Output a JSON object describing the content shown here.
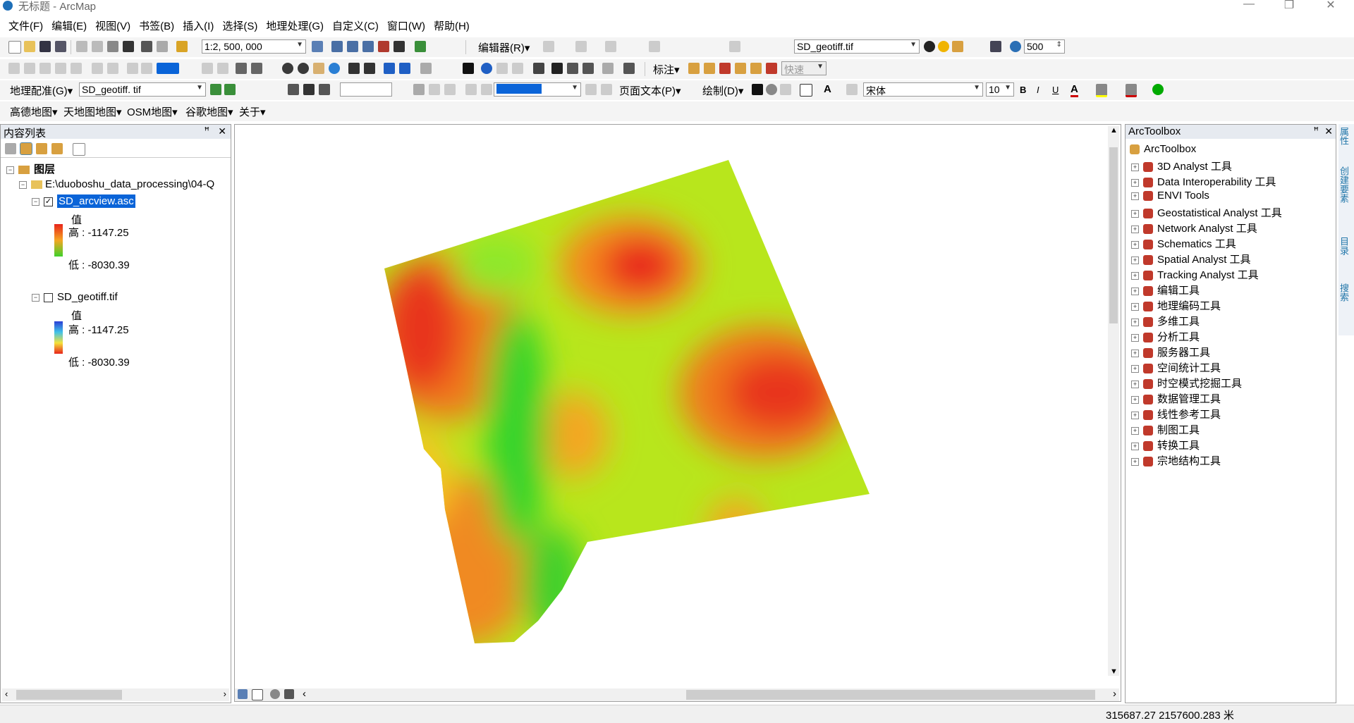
{
  "app": {
    "title": "无标题 - ArcMap",
    "window_buttons": [
      "—",
      "❐",
      "✕"
    ]
  },
  "menubar": [
    "文件(F)",
    "编辑(E)",
    "视图(V)",
    "书签(B)",
    "插入(I)",
    "选择(S)",
    "地理处理(G)",
    "自定义(C)",
    "窗口(W)",
    "帮助(H)"
  ],
  "toolbar1": {
    "scale_value": "1:2, 500, 000",
    "editor_label": "编辑器(R)▾",
    "layer_combo": "SD_geotiff.tif",
    "effects_value": "500"
  },
  "toolbar2": {
    "quick_label": "快速",
    "annotation_label": "标注▾"
  },
  "toolbar3": {
    "georef_label": "地理配准(G)▾",
    "georef_layer": "SD_geotiff. tif",
    "layout_text_label": "页面文本(P)▾",
    "draw_label": "绘制(D)▾",
    "font_name": "宋体",
    "font_size": "10",
    "bold": "B",
    "italic": "I",
    "underline": "U"
  },
  "toolbar4": [
    "高德地图▾",
    "天地图地图▾",
    "OSM地图▾",
    "谷歌地图▾",
    "关于▾"
  ],
  "toc": {
    "title": "内容列表",
    "root": "图层",
    "folder": "E:\\duoboshu_data_processing\\04-Q",
    "layers": [
      {
        "name": "SD_arcview.asc",
        "checked": true,
        "value_label": "值",
        "high": "高 : -1147.25",
        "low": "低 : -8030.39",
        "colors": [
          "#e8241a",
          "#f5a623",
          "#3fd12b"
        ]
      },
      {
        "name": "SD_geotiff.tif",
        "checked": false,
        "value_label": "值",
        "high": "高 : -1147.25",
        "low": "低 : -8030.39",
        "colors": [
          "#2a3fd6",
          "#41c2e8",
          "#e8241a"
        ]
      }
    ]
  },
  "toolbox": {
    "title": "ArcToolbox",
    "root": "ArcToolbox",
    "items": [
      "3D Analyst 工具",
      "Data Interoperability 工具",
      "ENVI Tools",
      "Geostatistical Analyst 工具",
      "Network Analyst 工具",
      "Schematics 工具",
      "Spatial Analyst 工具",
      "Tracking Analyst 工具",
      "编辑工具",
      "地理编码工具",
      "多维工具",
      "分析工具",
      "服务器工具",
      "空间统计工具",
      "时空模式挖掘工具",
      "数据管理工具",
      "线性参考工具",
      "制图工具",
      "转换工具",
      "宗地结构工具"
    ]
  },
  "side_tabs": [
    "属性",
    "创建要素",
    "目录",
    "搜索"
  ],
  "status": {
    "coordinates": "315687.27  2157600.283 米"
  },
  "colors": {
    "selection": "#0a64d8",
    "panel_header": "#e6eaf0"
  }
}
